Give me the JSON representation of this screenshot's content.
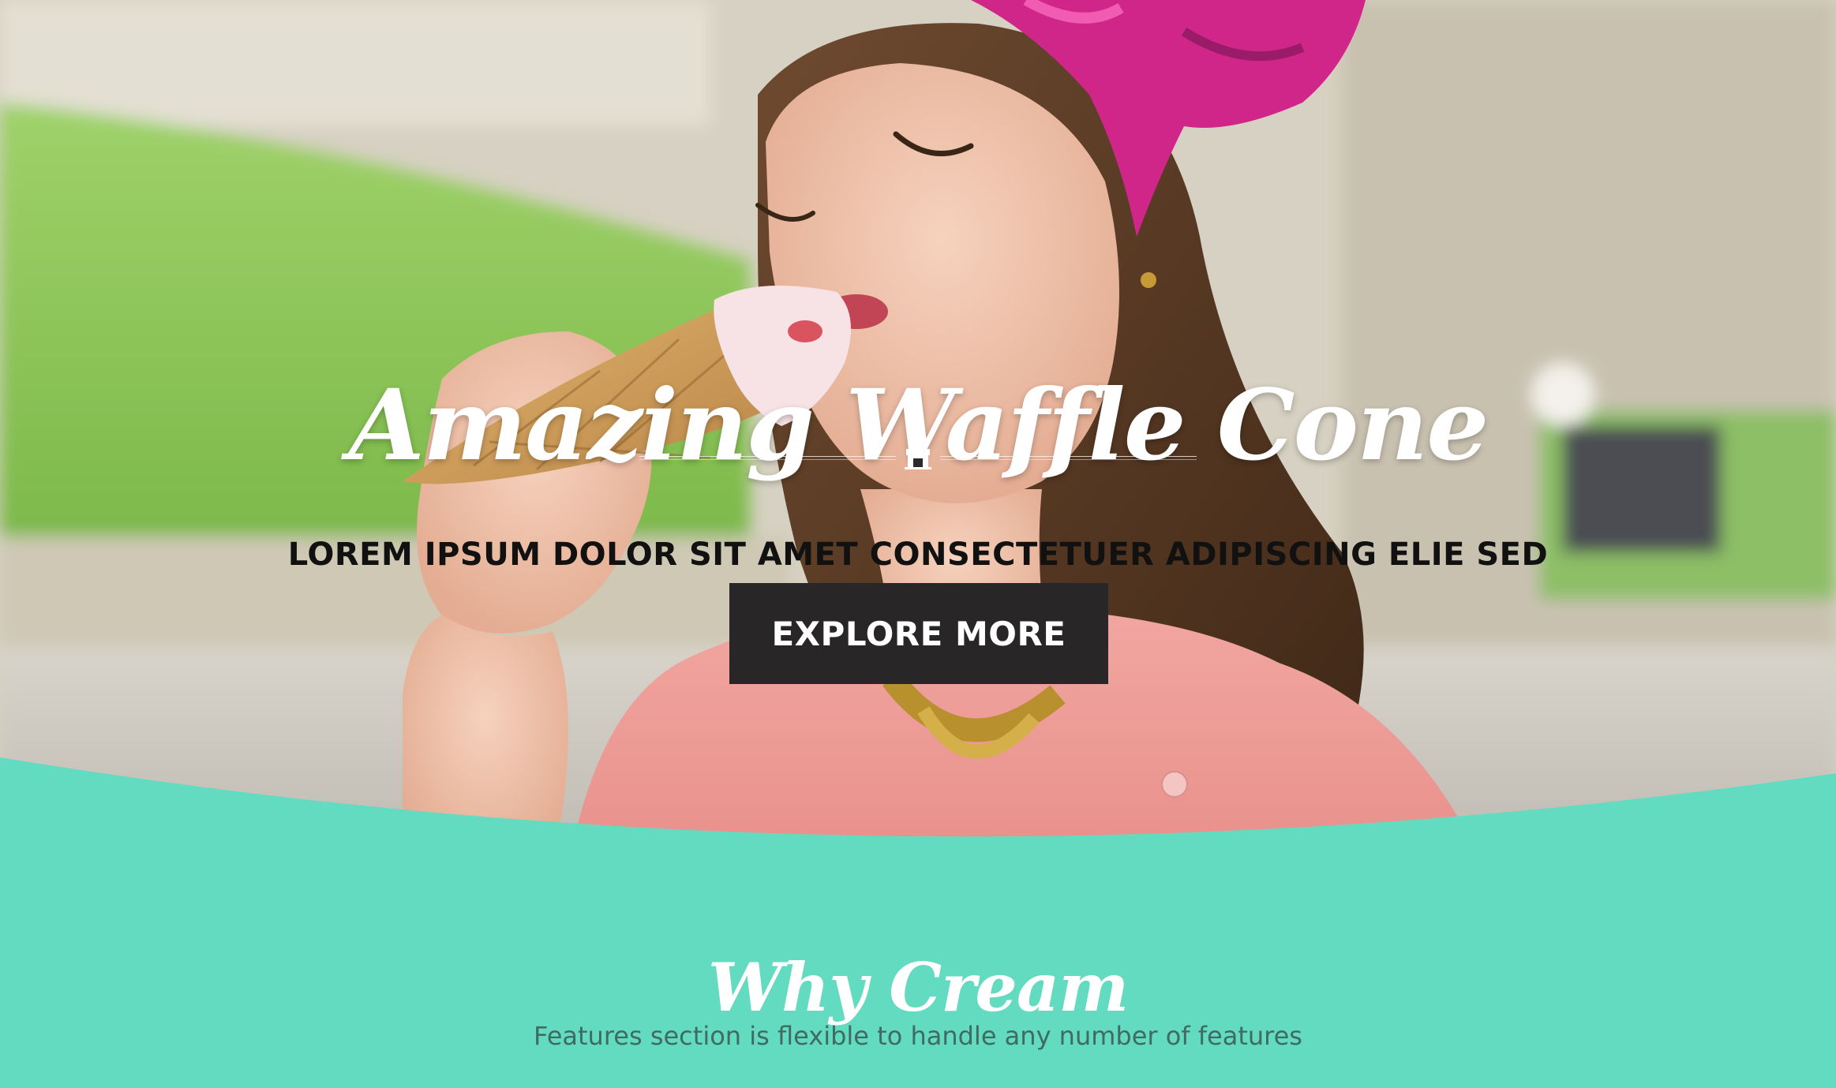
{
  "hero": {
    "title": "Amazing Waffle Cone",
    "subtitle": "LOREM IPSUM DOLOR SIT AMET CONSECTETUER ADIPISCING ELIE SED",
    "button_label": "EXPLORE MORE",
    "divider_icon": "shop-icon"
  },
  "features": {
    "title": "Why Cream",
    "subtitle": "Features section is flexible to handle any number of features"
  },
  "colors": {
    "accent": "#62dbc1",
    "button_bg": "#282626",
    "button_text": "#ffffff",
    "title_text": "#ffffff",
    "subtitle_text": "#111111",
    "features_subtitle_text": "#3f6b61"
  }
}
